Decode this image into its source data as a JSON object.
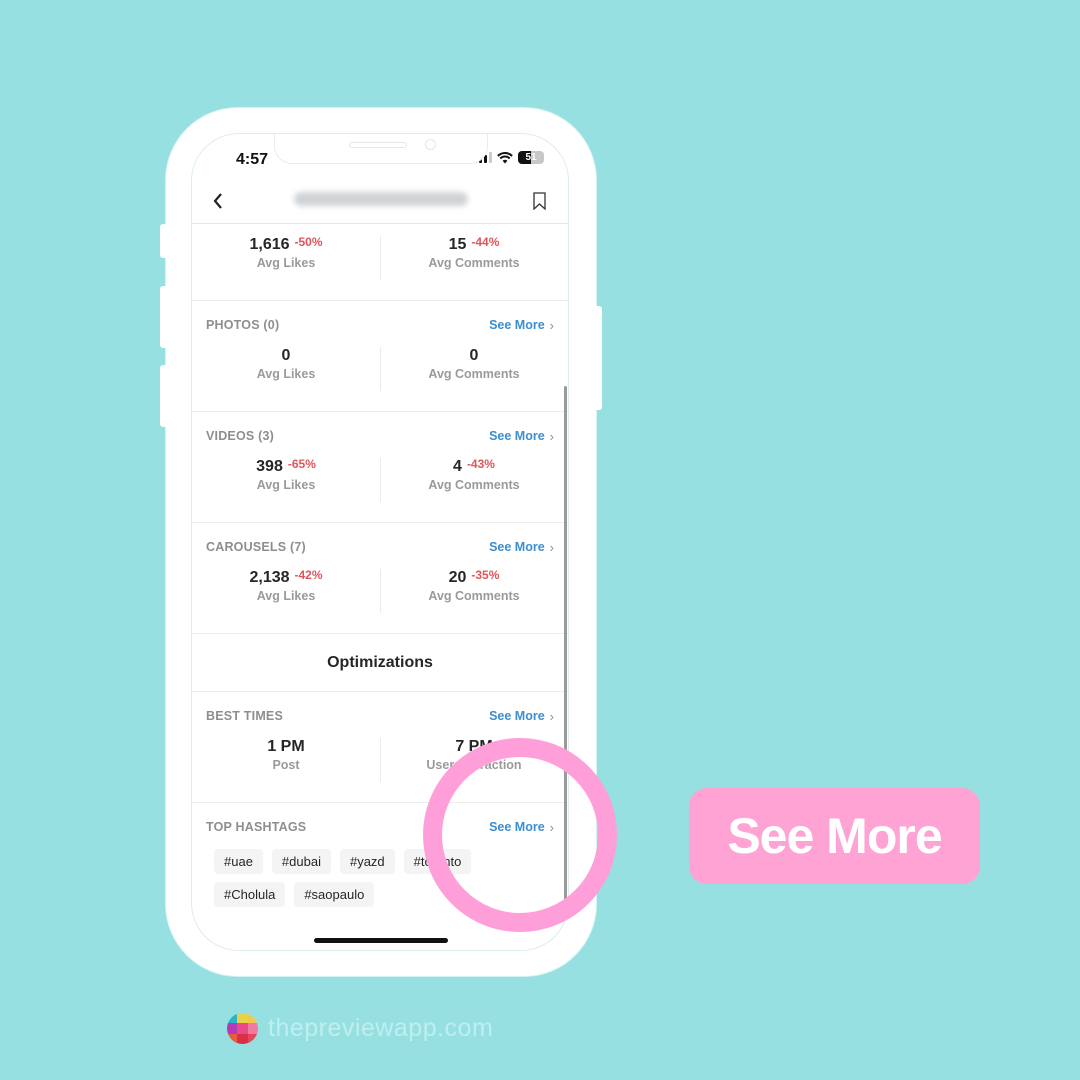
{
  "status_bar": {
    "time": "4:57",
    "battery": "51",
    "battery_level": 0.51
  },
  "navbar": {
    "back_icon": "chevron-left-icon",
    "title": "(blurred account name)",
    "bookmark_icon": "bookmark-icon"
  },
  "summary": {
    "stats": [
      {
        "value": "1,616",
        "delta": "-50%",
        "label": "Avg Likes"
      },
      {
        "value": "15",
        "delta": "-44%",
        "label": "Avg Comments"
      }
    ]
  },
  "sections": [
    {
      "title": "PHOTOS (0)",
      "see_more": "See More",
      "stats": [
        {
          "value": "0",
          "delta": "",
          "label": "Avg Likes"
        },
        {
          "value": "0",
          "delta": "",
          "label": "Avg Comments"
        }
      ]
    },
    {
      "title": "VIDEOS (3)",
      "see_more": "See More",
      "stats": [
        {
          "value": "398",
          "delta": "-65%",
          "label": "Avg Likes"
        },
        {
          "value": "4",
          "delta": "-43%",
          "label": "Avg Comments"
        }
      ]
    },
    {
      "title": "CAROUSELS (7)",
      "see_more": "See More",
      "stats": [
        {
          "value": "2,138",
          "delta": "-42%",
          "label": "Avg Likes"
        },
        {
          "value": "20",
          "delta": "-35%",
          "label": "Avg Comments"
        }
      ]
    }
  ],
  "optimizations": {
    "title": "Optimizations",
    "best_times": {
      "title": "BEST TIMES",
      "see_more": "See More",
      "stats": [
        {
          "value": "1 PM",
          "label": "Post"
        },
        {
          "value": "7 PM",
          "label": "User Interaction"
        }
      ]
    },
    "top_hashtags": {
      "title": "TOP HASHTAGS",
      "see_more": "See More",
      "tags": [
        "#uae",
        "#dubai",
        "#yazd",
        "#toronto",
        "#Cholula",
        "#saopaulo"
      ]
    }
  },
  "callout": {
    "label": "See More"
  },
  "brand": {
    "text": "thepreviewapp.com"
  },
  "colors": {
    "background": "#97e0e2",
    "accent_pink": "#ffa3d5",
    "link_blue": "#3b8fd1",
    "negative_red": "#e0555a",
    "logo_tiles": [
      "#2bb3c8",
      "#e6d34a",
      "#f2c94c",
      "#b43ab8",
      "#e84a8a",
      "#f07aa0",
      "#e85c3c",
      "#d9304a",
      "#e8455c"
    ]
  }
}
